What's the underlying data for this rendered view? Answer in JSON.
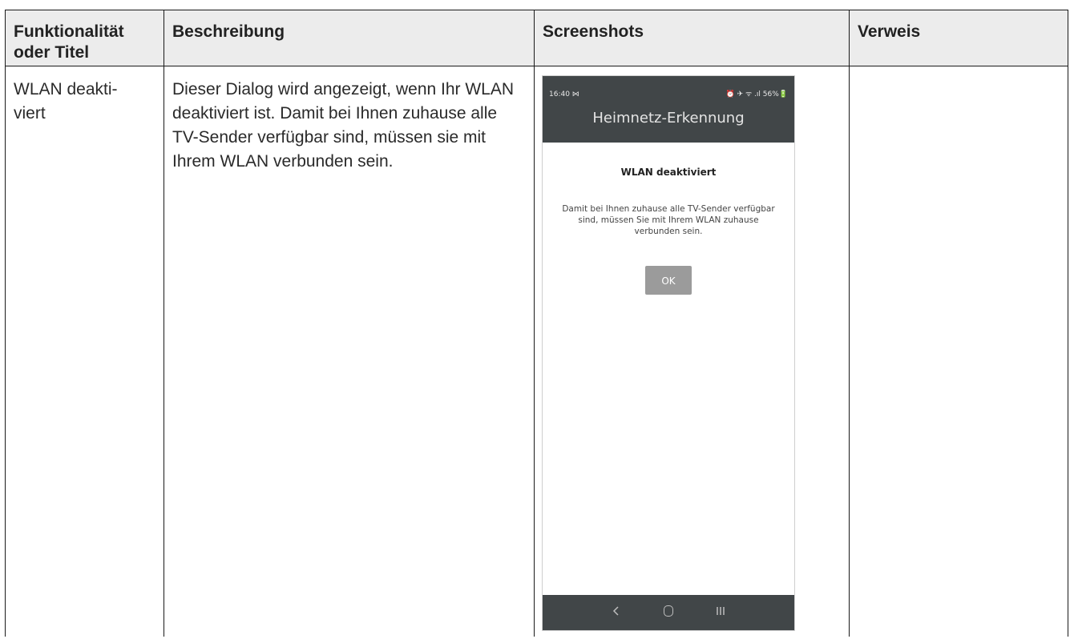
{
  "table": {
    "headers": [
      "Funktionalität oder Titel",
      "Beschreibung",
      "Screenshots",
      "Verweis"
    ],
    "row": {
      "title": "WLAN deakti-\nviert",
      "description": "Dieser Dialog wird angezeigt, wenn Ihr WLAN deaktiviert ist. Damit bei Ihnen zuhause alle TV-Sender verfügbar sind, müssen sie mit Ihrem WLAN verbunden sein.",
      "reference": ""
    }
  },
  "phone": {
    "status_time": "16:40 ⋈",
    "status_right": "⏰ ✈ ᯤ .ıl 56%🔋",
    "app_title": "Heimnetz-Erkennung",
    "dialog_title": "WLAN deaktiviert",
    "dialog_body": "Damit bei Ihnen zuhause alle TV-Sender verfügbar sind, müssen Sie mit Ihrem WLAN zuhause verbunden sein.",
    "ok_label": "OK",
    "nav": {
      "back_icon": "back-icon",
      "home_icon": "home-icon",
      "recents_icon": "recents-icon"
    }
  }
}
